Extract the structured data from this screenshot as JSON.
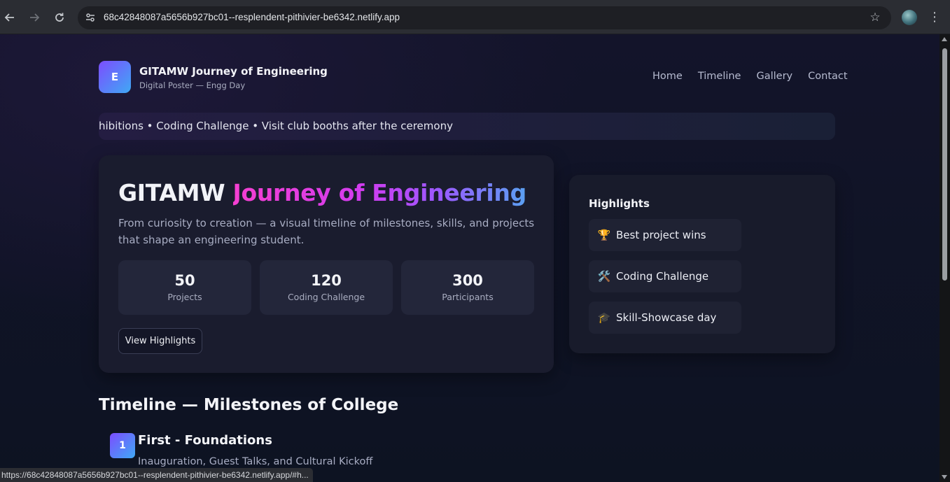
{
  "browser": {
    "url": "68c42848087a5656b927bc01--resplendent-pithivier-be6342.netlify.app",
    "status_url": "https://68c42848087a5656b927bc01--resplendent-pithivier-be6342.netlify.app/#h..."
  },
  "header": {
    "logo_letter": "E",
    "title": "GITAMW Journey of Engineering",
    "subtitle": "Digital Poster — Engg Day",
    "nav": [
      "Home",
      "Timeline",
      "Gallery",
      "Contact"
    ]
  },
  "ticker": {
    "text": "hibitions • Coding Challenge • Visit club booths after the ceremony"
  },
  "hero": {
    "title_plain": "GITAMW",
    "title_gradient": "Journey of Engineering",
    "description": "From curiosity to creation — a visual timeline of milestones, skills, and projects that shape an engineering student.",
    "stats": [
      {
        "value": "50",
        "label": "Projects"
      },
      {
        "value": "120",
        "label": "Coding Challenge"
      },
      {
        "value": "300",
        "label": "Participants"
      }
    ],
    "button_label": "View Highlights"
  },
  "highlights": {
    "title": "Highlights",
    "items": [
      {
        "icon": "trophy-icon",
        "emoji": "🏆",
        "label": "Best project wins"
      },
      {
        "icon": "tools-icon",
        "emoji": "🛠️",
        "label": "Coding Challenge"
      },
      {
        "icon": "graduation-cap-icon",
        "emoji": "🎓",
        "label": "Skill-Showcase day"
      }
    ]
  },
  "timeline": {
    "title": "Timeline — Milestones of College",
    "items": [
      {
        "number": "1",
        "heading": "First - Foundations",
        "description": "Inauguration, Guest Talks, and Cultural Kickoff"
      }
    ]
  },
  "colors": {
    "accent_start": "#7c4dff",
    "accent_end": "#3fa9f5",
    "gradient_pink": "#f53fd1",
    "background": "#0f1220"
  }
}
